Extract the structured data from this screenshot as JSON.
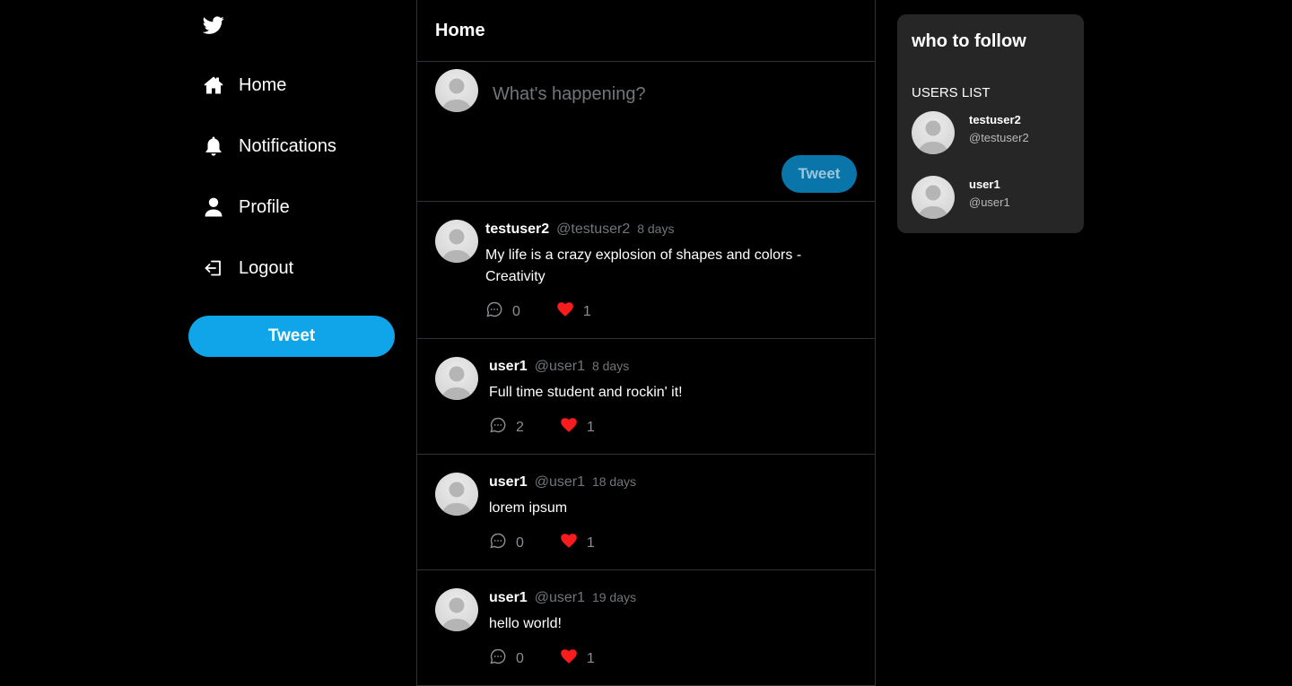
{
  "sidebar": {
    "logo_icon": "twitter-bird-icon",
    "items": [
      {
        "label": "Home",
        "icon": "home-icon"
      },
      {
        "label": "Notifications",
        "icon": "bell-icon"
      },
      {
        "label": "Profile",
        "icon": "user-icon"
      },
      {
        "label": "Logout",
        "icon": "logout-icon"
      }
    ],
    "tweet_button": "Tweet"
  },
  "feed": {
    "title": "Home",
    "composer": {
      "placeholder": "What's happening?",
      "value": "",
      "tweet_button": "Tweet"
    },
    "tweets": [
      {
        "name": "testuser2",
        "handle": "@testuser2",
        "time": "8 days",
        "text": "My life is a crazy explosion of shapes and colors - Creativity",
        "comments": "0",
        "likes": "1"
      },
      {
        "name": "user1",
        "handle": "@user1",
        "time": "8 days",
        "text": "Full time student and rockin' it!",
        "comments": "2",
        "likes": "1"
      },
      {
        "name": "user1",
        "handle": "@user1",
        "time": "18 days",
        "text": "lorem ipsum",
        "comments": "0",
        "likes": "1"
      },
      {
        "name": "user1",
        "handle": "@user1",
        "time": "19 days",
        "text": "hello world!",
        "comments": "0",
        "likes": "1"
      }
    ]
  },
  "follow": {
    "title": "who to follow",
    "list_label": "USERS LIST",
    "users": [
      {
        "name": "testuser2",
        "handle": "@testuser2"
      },
      {
        "name": "user1",
        "handle": "@user1"
      }
    ]
  },
  "colors": {
    "background": "#000000",
    "accent": "#10a5e9",
    "composer_button": "#0a75a8",
    "like": "#f91c1c",
    "panel": "#262626",
    "muted_text": "#71767b"
  }
}
